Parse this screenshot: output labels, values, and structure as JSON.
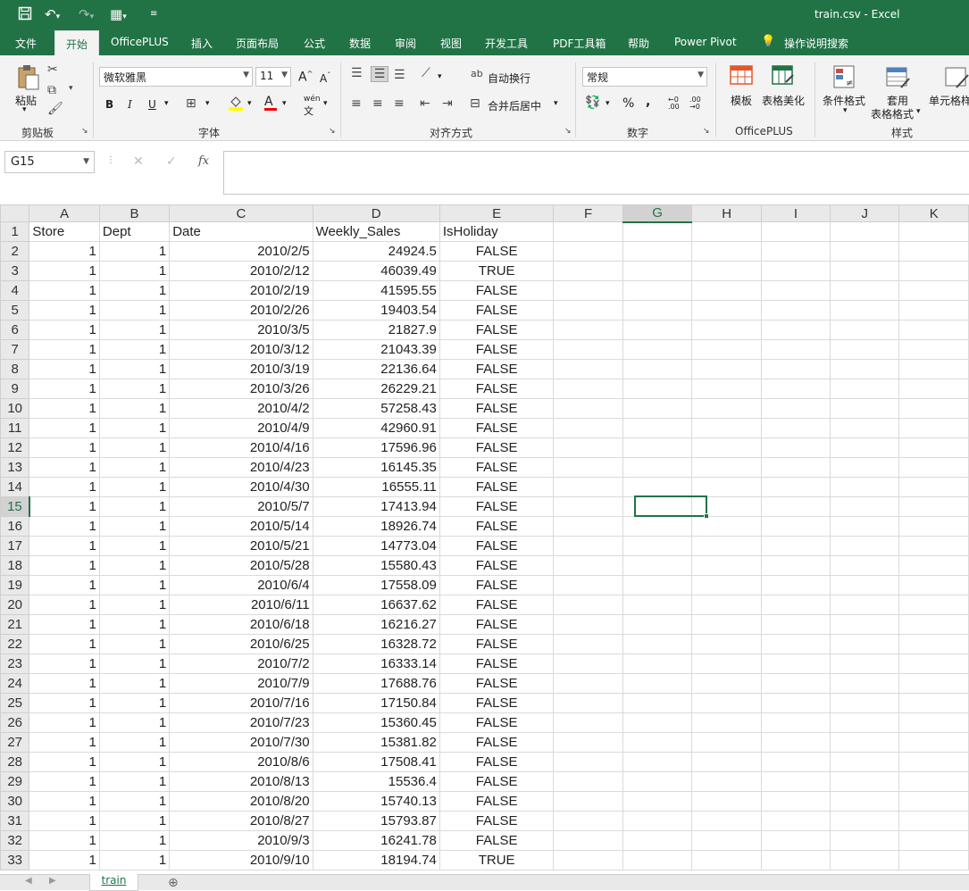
{
  "window": {
    "title": "train.csv  -  Excel",
    "quick_access": {
      "save_icon": "save-icon",
      "undo_icon": "undo-icon",
      "redo_icon": "redo-icon",
      "form_icon": "form-icon",
      "customize_icon": "customize-icon"
    }
  },
  "tabs": [
    "文件",
    "开始",
    "OfficePLUS",
    "插入",
    "页面布局",
    "公式",
    "数据",
    "审阅",
    "视图",
    "开发工具",
    "PDF工具箱",
    "帮助",
    "Power Pivot"
  ],
  "active_tab": "开始",
  "tell_me": "操作说明搜索",
  "ribbon": {
    "clipboard": {
      "paste": "粘贴",
      "group": "剪贴板"
    },
    "font": {
      "name": "微软雅黑",
      "size": "11",
      "bold": "B",
      "italic": "I",
      "underline": "U",
      "group": "字体",
      "grow": "A",
      "shrink": "A",
      "font_color_letter": "A",
      "wen": "wén"
    },
    "alignment": {
      "wrap": "自动换行",
      "merge": "合并后居中",
      "group": "对齐方式"
    },
    "number": {
      "format": "常规",
      "percent": "%",
      "comma": ",",
      "group": "数字"
    },
    "officeplus": {
      "template": "模板",
      "beautify": "表格美化",
      "group": "OfficePLUS"
    },
    "styles": {
      "conditional": "条件格式",
      "table_format_1": "套用",
      "table_format_2": "表格格式",
      "cell_styles": "单元格样",
      "group": "样式"
    }
  },
  "formula_bar": {
    "name_box": "G15",
    "cancel": "✕",
    "enter": "✓",
    "fx": "fx",
    "value": ""
  },
  "columns": [
    "A",
    "B",
    "C",
    "D",
    "E",
    "F",
    "G",
    "H",
    "I",
    "J",
    "K"
  ],
  "header_row": [
    "Store",
    "Dept",
    "Date",
    "Weekly_Sales",
    "IsHoliday"
  ],
  "rows": [
    [
      "1",
      "1",
      "2010/2/5",
      "24924.5",
      "FALSE"
    ],
    [
      "1",
      "1",
      "2010/2/12",
      "46039.49",
      "TRUE"
    ],
    [
      "1",
      "1",
      "2010/2/19",
      "41595.55",
      "FALSE"
    ],
    [
      "1",
      "1",
      "2010/2/26",
      "19403.54",
      "FALSE"
    ],
    [
      "1",
      "1",
      "2010/3/5",
      "21827.9",
      "FALSE"
    ],
    [
      "1",
      "1",
      "2010/3/12",
      "21043.39",
      "FALSE"
    ],
    [
      "1",
      "1",
      "2010/3/19",
      "22136.64",
      "FALSE"
    ],
    [
      "1",
      "1",
      "2010/3/26",
      "26229.21",
      "FALSE"
    ],
    [
      "1",
      "1",
      "2010/4/2",
      "57258.43",
      "FALSE"
    ],
    [
      "1",
      "1",
      "2010/4/9",
      "42960.91",
      "FALSE"
    ],
    [
      "1",
      "1",
      "2010/4/16",
      "17596.96",
      "FALSE"
    ],
    [
      "1",
      "1",
      "2010/4/23",
      "16145.35",
      "FALSE"
    ],
    [
      "1",
      "1",
      "2010/4/30",
      "16555.11",
      "FALSE"
    ],
    [
      "1",
      "1",
      "2010/5/7",
      "17413.94",
      "FALSE"
    ],
    [
      "1",
      "1",
      "2010/5/14",
      "18926.74",
      "FALSE"
    ],
    [
      "1",
      "1",
      "2010/5/21",
      "14773.04",
      "FALSE"
    ],
    [
      "1",
      "1",
      "2010/5/28",
      "15580.43",
      "FALSE"
    ],
    [
      "1",
      "1",
      "2010/6/4",
      "17558.09",
      "FALSE"
    ],
    [
      "1",
      "1",
      "2010/6/11",
      "16637.62",
      "FALSE"
    ],
    [
      "1",
      "1",
      "2010/6/18",
      "16216.27",
      "FALSE"
    ],
    [
      "1",
      "1",
      "2010/6/25",
      "16328.72",
      "FALSE"
    ],
    [
      "1",
      "1",
      "2010/7/2",
      "16333.14",
      "FALSE"
    ],
    [
      "1",
      "1",
      "2010/7/9",
      "17688.76",
      "FALSE"
    ],
    [
      "1",
      "1",
      "2010/7/16",
      "17150.84",
      "FALSE"
    ],
    [
      "1",
      "1",
      "2010/7/23",
      "15360.45",
      "FALSE"
    ],
    [
      "1",
      "1",
      "2010/7/30",
      "15381.82",
      "FALSE"
    ],
    [
      "1",
      "1",
      "2010/8/6",
      "17508.41",
      "FALSE"
    ],
    [
      "1",
      "1",
      "2010/8/13",
      "15536.4",
      "FALSE"
    ],
    [
      "1",
      "1",
      "2010/8/20",
      "15740.13",
      "FALSE"
    ],
    [
      "1",
      "1",
      "2010/8/27",
      "15793.87",
      "FALSE"
    ],
    [
      "1",
      "1",
      "2010/9/3",
      "16241.78",
      "FALSE"
    ],
    [
      "1",
      "1",
      "2010/9/10",
      "18194.74",
      "TRUE"
    ]
  ],
  "selected_cell": "G15",
  "sheet_tab": "train",
  "add_sheet_icon": "plus-circle-icon",
  "colors": {
    "accent": "#217346",
    "header_bg": "#e9e9e9",
    "ribbon_bg": "#f3f3f3"
  }
}
